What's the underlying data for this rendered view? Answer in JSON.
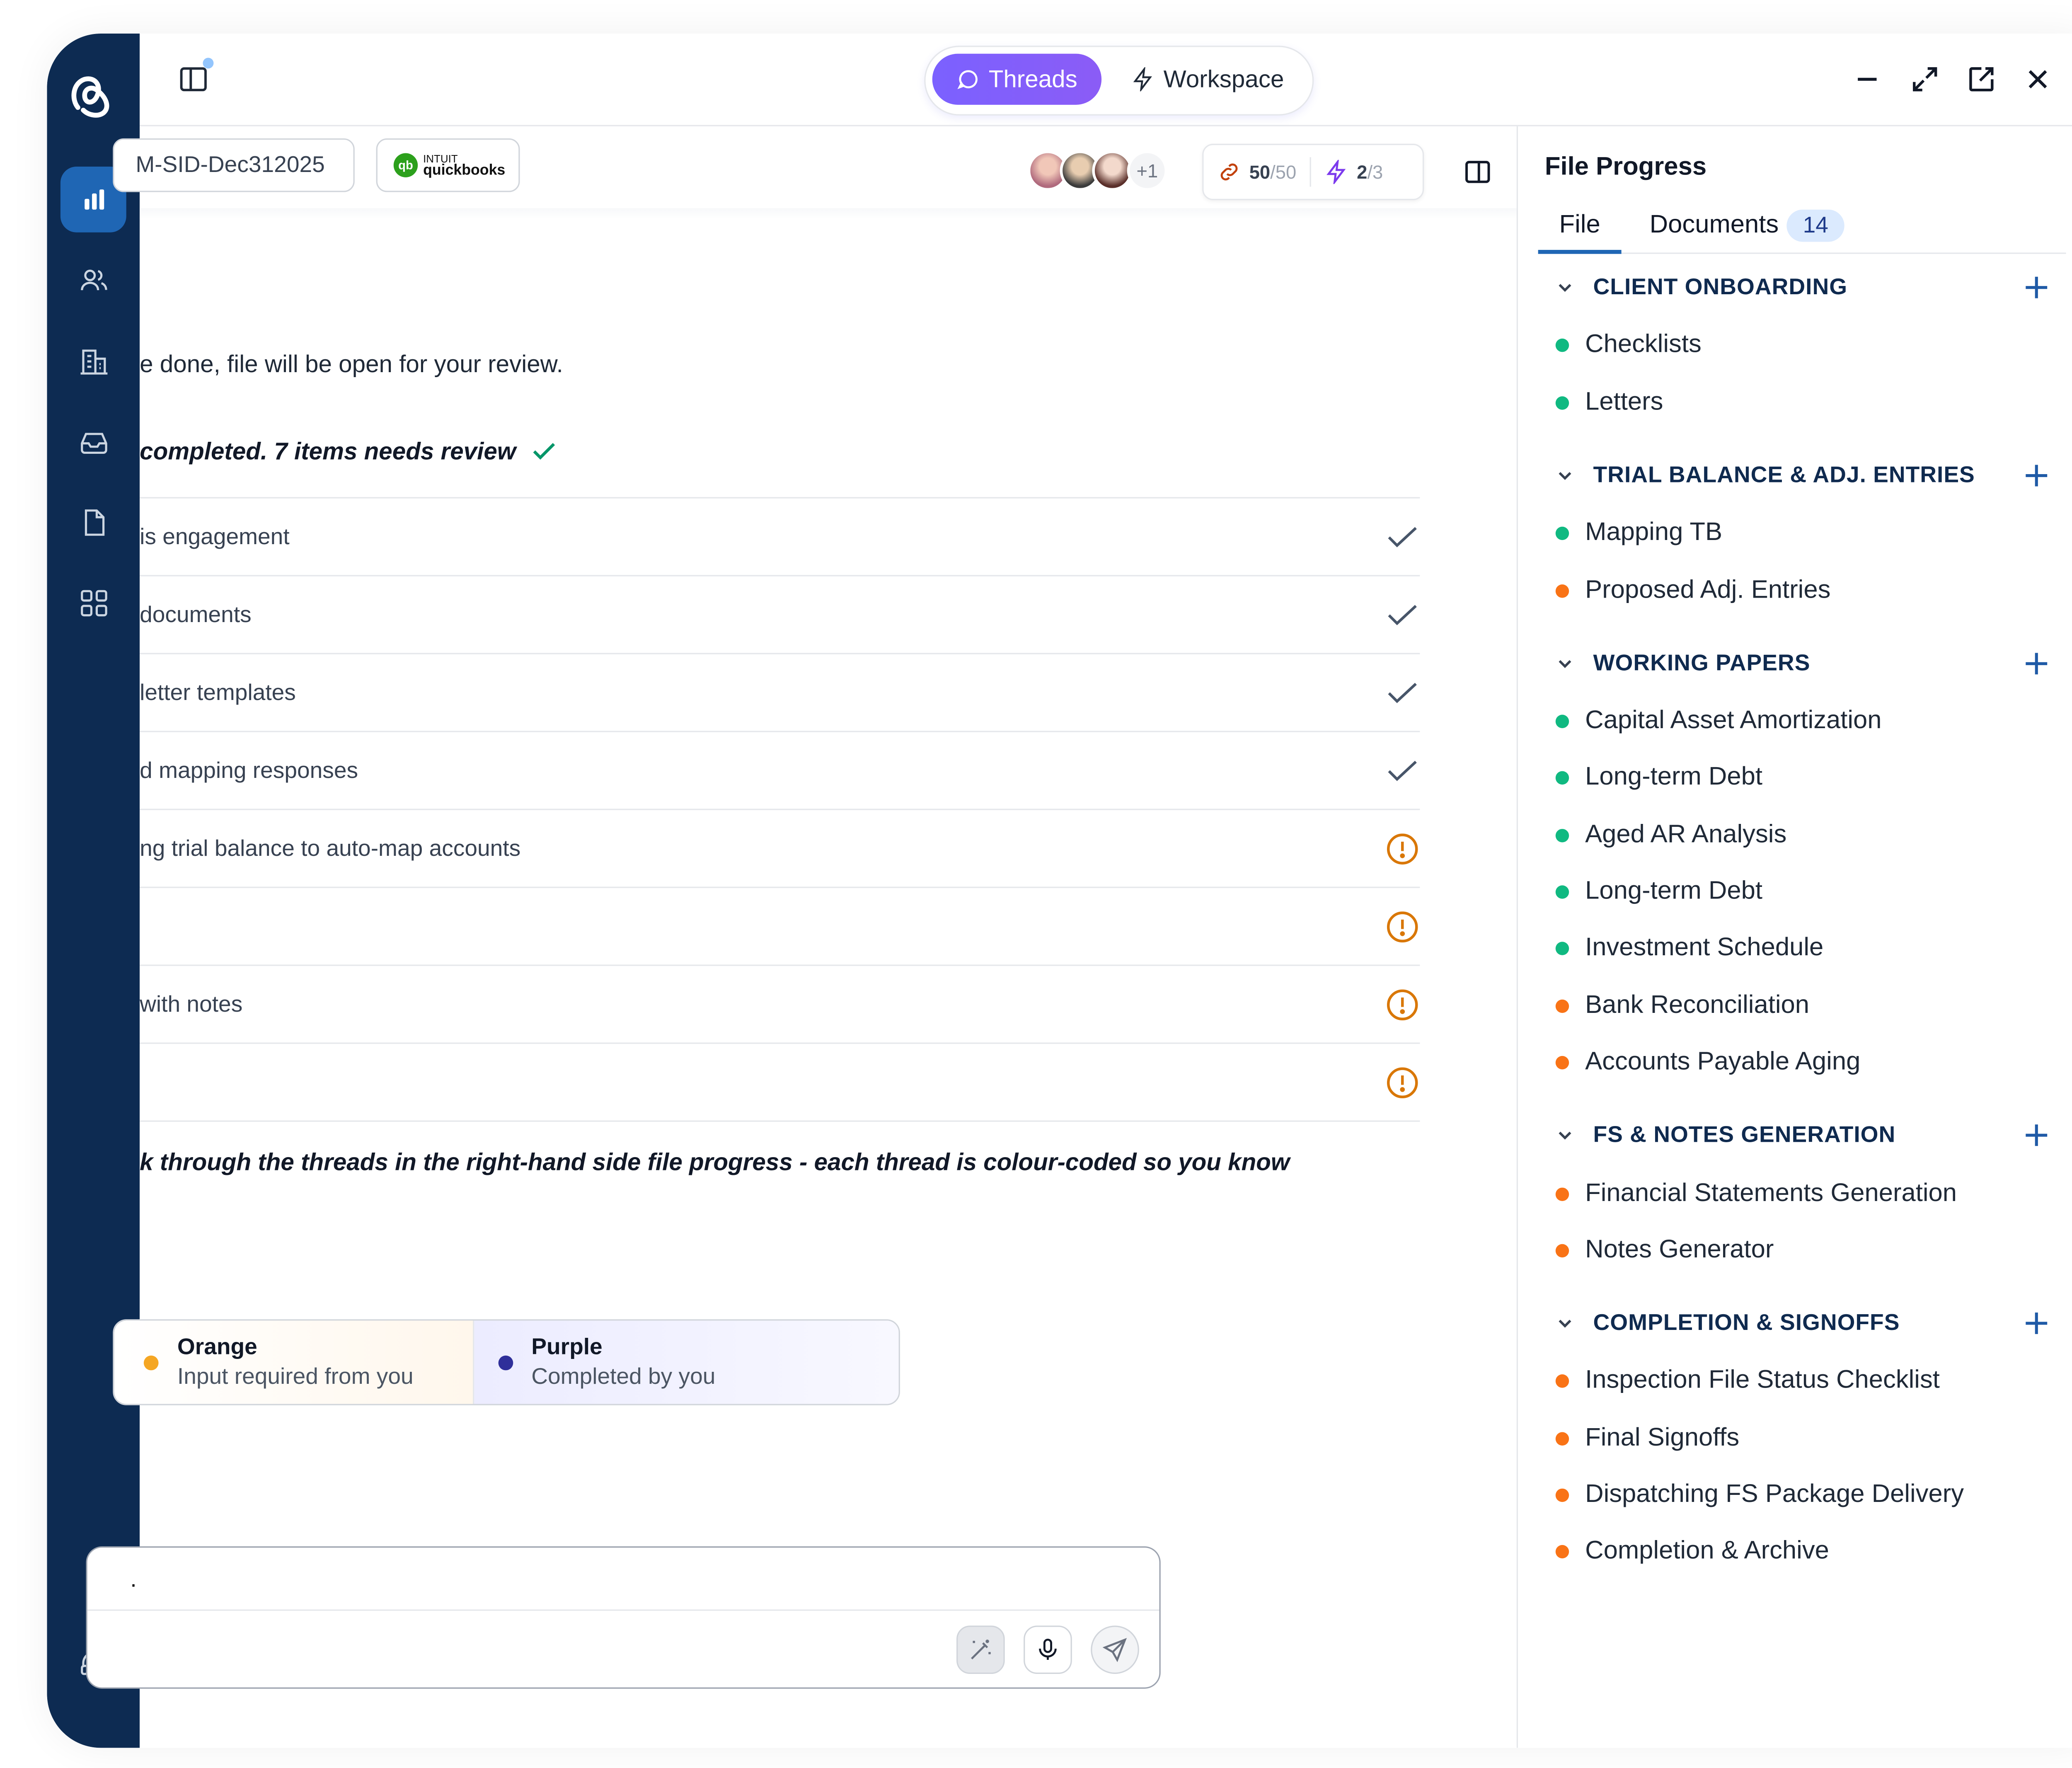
{
  "topbar": {
    "mode_tabs": [
      {
        "label": "Threads",
        "active": true
      },
      {
        "label": "Workspace",
        "active": false
      }
    ]
  },
  "subheader": {
    "file_chip": "M-SID-Dec312025",
    "integration": {
      "brand_top": "INTUIT",
      "brand_name": "quickbooks",
      "mark": "qb"
    },
    "avatars_more": "+1",
    "counter_a": {
      "value": "50",
      "total": "/50"
    },
    "counter_b": {
      "value": "2",
      "total": "/3"
    }
  },
  "conversation": {
    "intro": "e done, file will be open for your review.",
    "status_summary": " completed. 7 items needs review",
    "tasks": [
      {
        "label": "is engagement",
        "status": "done"
      },
      {
        "label": "documents",
        "status": "done"
      },
      {
        "label": "letter templates",
        "status": "done"
      },
      {
        "label": "d mapping responses",
        "status": "done"
      },
      {
        "label": "ng trial balance to auto-map accounts",
        "status": "attention"
      },
      {
        "label": "",
        "status": "attention"
      },
      {
        "label": " with notes",
        "status": "attention"
      },
      {
        "label": "",
        "status": "attention"
      }
    ],
    "guidance": "k through the threads in the right-hand side file progress - each thread is colour-coded so you know",
    "legend": [
      {
        "title": "Orange",
        "desc": "Input required from you",
        "color": "#f5a623"
      },
      {
        "title": "Purple",
        "desc": "Completed by you",
        "color": "#2f2f9a"
      }
    ],
    "composer_value": "."
  },
  "file_progress": {
    "title": "File Progress",
    "tabs": [
      {
        "label": "File"
      },
      {
        "label": "Documents",
        "count": "14"
      }
    ],
    "sections": [
      {
        "title": "CLIENT ONBOARDING",
        "items": [
          {
            "label": "Checklists",
            "status": "green"
          },
          {
            "label": "Letters",
            "status": "green"
          }
        ]
      },
      {
        "title": "TRIAL BALANCE & ADJ. ENTRIES",
        "items": [
          {
            "label": "Mapping TB",
            "status": "green"
          },
          {
            "label": "Proposed Adj. Entries",
            "status": "orange"
          }
        ]
      },
      {
        "title": "WORKING PAPERS",
        "items": [
          {
            "label": "Capital Asset Amortization",
            "status": "green"
          },
          {
            "label": "Long-term Debt",
            "status": "green"
          },
          {
            "label": "Aged AR Analysis",
            "status": "green"
          },
          {
            "label": "Long-term Debt",
            "status": "green"
          },
          {
            "label": "Investment Schedule",
            "status": "green"
          },
          {
            "label": "Bank Reconciliation",
            "status": "orange"
          },
          {
            "label": "Accounts Payable Aging",
            "status": "orange"
          }
        ]
      },
      {
        "title": "FS & NOTES GENERATION",
        "items": [
          {
            "label": "Financial Statements Generation",
            "status": "orange"
          },
          {
            "label": "Notes Generator",
            "status": "orange"
          }
        ]
      },
      {
        "title": "COMPLETION & SIGNOFFS",
        "items": [
          {
            "label": "Inspection File Status Checklist",
            "status": "orange"
          },
          {
            "label": "Final Signoffs",
            "status": "orange"
          },
          {
            "label": "Dispatching FS Package Delivery",
            "status": "orange"
          },
          {
            "label": "Completion & Archive",
            "status": "orange"
          }
        ]
      }
    ]
  },
  "colors": {
    "rail": "#0d2b52",
    "rail_active": "#1f66b4",
    "accent": "#7b61ff",
    "status_green": "#10b981",
    "status_orange": "#f97316",
    "attention": "#d97706",
    "done": "#475569"
  },
  "icons": {
    "rail": [
      "logo-icon",
      "analytics-icon",
      "users-icon",
      "building-icon",
      "inbox-icon",
      "document-icon",
      "apps-grid-icon",
      "headset-icon"
    ],
    "window": [
      "minimize-icon",
      "expand-icon",
      "popout-icon",
      "close-icon"
    ]
  }
}
